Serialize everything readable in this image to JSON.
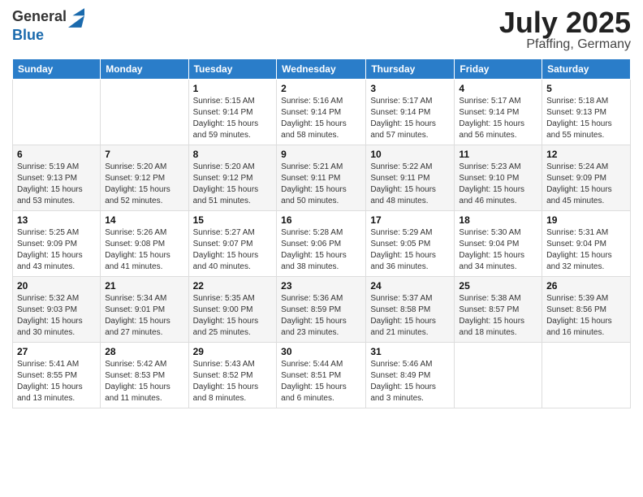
{
  "logo": {
    "general": "General",
    "blue": "Blue"
  },
  "title": {
    "month": "July 2025",
    "location": "Pfaffing, Germany"
  },
  "weekdays": [
    "Sunday",
    "Monday",
    "Tuesday",
    "Wednesday",
    "Thursday",
    "Friday",
    "Saturday"
  ],
  "weeks": [
    [
      {
        "day": "",
        "sunrise": "",
        "sunset": "",
        "daylight": ""
      },
      {
        "day": "",
        "sunrise": "",
        "sunset": "",
        "daylight": ""
      },
      {
        "day": "1",
        "sunrise": "Sunrise: 5:15 AM",
        "sunset": "Sunset: 9:14 PM",
        "daylight": "Daylight: 15 hours and 59 minutes."
      },
      {
        "day": "2",
        "sunrise": "Sunrise: 5:16 AM",
        "sunset": "Sunset: 9:14 PM",
        "daylight": "Daylight: 15 hours and 58 minutes."
      },
      {
        "day": "3",
        "sunrise": "Sunrise: 5:17 AM",
        "sunset": "Sunset: 9:14 PM",
        "daylight": "Daylight: 15 hours and 57 minutes."
      },
      {
        "day": "4",
        "sunrise": "Sunrise: 5:17 AM",
        "sunset": "Sunset: 9:14 PM",
        "daylight": "Daylight: 15 hours and 56 minutes."
      },
      {
        "day": "5",
        "sunrise": "Sunrise: 5:18 AM",
        "sunset": "Sunset: 9:13 PM",
        "daylight": "Daylight: 15 hours and 55 minutes."
      }
    ],
    [
      {
        "day": "6",
        "sunrise": "Sunrise: 5:19 AM",
        "sunset": "Sunset: 9:13 PM",
        "daylight": "Daylight: 15 hours and 53 minutes."
      },
      {
        "day": "7",
        "sunrise": "Sunrise: 5:20 AM",
        "sunset": "Sunset: 9:12 PM",
        "daylight": "Daylight: 15 hours and 52 minutes."
      },
      {
        "day": "8",
        "sunrise": "Sunrise: 5:20 AM",
        "sunset": "Sunset: 9:12 PM",
        "daylight": "Daylight: 15 hours and 51 minutes."
      },
      {
        "day": "9",
        "sunrise": "Sunrise: 5:21 AM",
        "sunset": "Sunset: 9:11 PM",
        "daylight": "Daylight: 15 hours and 50 minutes."
      },
      {
        "day": "10",
        "sunrise": "Sunrise: 5:22 AM",
        "sunset": "Sunset: 9:11 PM",
        "daylight": "Daylight: 15 hours and 48 minutes."
      },
      {
        "day": "11",
        "sunrise": "Sunrise: 5:23 AM",
        "sunset": "Sunset: 9:10 PM",
        "daylight": "Daylight: 15 hours and 46 minutes."
      },
      {
        "day": "12",
        "sunrise": "Sunrise: 5:24 AM",
        "sunset": "Sunset: 9:09 PM",
        "daylight": "Daylight: 15 hours and 45 minutes."
      }
    ],
    [
      {
        "day": "13",
        "sunrise": "Sunrise: 5:25 AM",
        "sunset": "Sunset: 9:09 PM",
        "daylight": "Daylight: 15 hours and 43 minutes."
      },
      {
        "day": "14",
        "sunrise": "Sunrise: 5:26 AM",
        "sunset": "Sunset: 9:08 PM",
        "daylight": "Daylight: 15 hours and 41 minutes."
      },
      {
        "day": "15",
        "sunrise": "Sunrise: 5:27 AM",
        "sunset": "Sunset: 9:07 PM",
        "daylight": "Daylight: 15 hours and 40 minutes."
      },
      {
        "day": "16",
        "sunrise": "Sunrise: 5:28 AM",
        "sunset": "Sunset: 9:06 PM",
        "daylight": "Daylight: 15 hours and 38 minutes."
      },
      {
        "day": "17",
        "sunrise": "Sunrise: 5:29 AM",
        "sunset": "Sunset: 9:05 PM",
        "daylight": "Daylight: 15 hours and 36 minutes."
      },
      {
        "day": "18",
        "sunrise": "Sunrise: 5:30 AM",
        "sunset": "Sunset: 9:04 PM",
        "daylight": "Daylight: 15 hours and 34 minutes."
      },
      {
        "day": "19",
        "sunrise": "Sunrise: 5:31 AM",
        "sunset": "Sunset: 9:04 PM",
        "daylight": "Daylight: 15 hours and 32 minutes."
      }
    ],
    [
      {
        "day": "20",
        "sunrise": "Sunrise: 5:32 AM",
        "sunset": "Sunset: 9:03 PM",
        "daylight": "Daylight: 15 hours and 30 minutes."
      },
      {
        "day": "21",
        "sunrise": "Sunrise: 5:34 AM",
        "sunset": "Sunset: 9:01 PM",
        "daylight": "Daylight: 15 hours and 27 minutes."
      },
      {
        "day": "22",
        "sunrise": "Sunrise: 5:35 AM",
        "sunset": "Sunset: 9:00 PM",
        "daylight": "Daylight: 15 hours and 25 minutes."
      },
      {
        "day": "23",
        "sunrise": "Sunrise: 5:36 AM",
        "sunset": "Sunset: 8:59 PM",
        "daylight": "Daylight: 15 hours and 23 minutes."
      },
      {
        "day": "24",
        "sunrise": "Sunrise: 5:37 AM",
        "sunset": "Sunset: 8:58 PM",
        "daylight": "Daylight: 15 hours and 21 minutes."
      },
      {
        "day": "25",
        "sunrise": "Sunrise: 5:38 AM",
        "sunset": "Sunset: 8:57 PM",
        "daylight": "Daylight: 15 hours and 18 minutes."
      },
      {
        "day": "26",
        "sunrise": "Sunrise: 5:39 AM",
        "sunset": "Sunset: 8:56 PM",
        "daylight": "Daylight: 15 hours and 16 minutes."
      }
    ],
    [
      {
        "day": "27",
        "sunrise": "Sunrise: 5:41 AM",
        "sunset": "Sunset: 8:55 PM",
        "daylight": "Daylight: 15 hours and 13 minutes."
      },
      {
        "day": "28",
        "sunrise": "Sunrise: 5:42 AM",
        "sunset": "Sunset: 8:53 PM",
        "daylight": "Daylight: 15 hours and 11 minutes."
      },
      {
        "day": "29",
        "sunrise": "Sunrise: 5:43 AM",
        "sunset": "Sunset: 8:52 PM",
        "daylight": "Daylight: 15 hours and 8 minutes."
      },
      {
        "day": "30",
        "sunrise": "Sunrise: 5:44 AM",
        "sunset": "Sunset: 8:51 PM",
        "daylight": "Daylight: 15 hours and 6 minutes."
      },
      {
        "day": "31",
        "sunrise": "Sunrise: 5:46 AM",
        "sunset": "Sunset: 8:49 PM",
        "daylight": "Daylight: 15 hours and 3 minutes."
      },
      {
        "day": "",
        "sunrise": "",
        "sunset": "",
        "daylight": ""
      },
      {
        "day": "",
        "sunrise": "",
        "sunset": "",
        "daylight": ""
      }
    ]
  ]
}
